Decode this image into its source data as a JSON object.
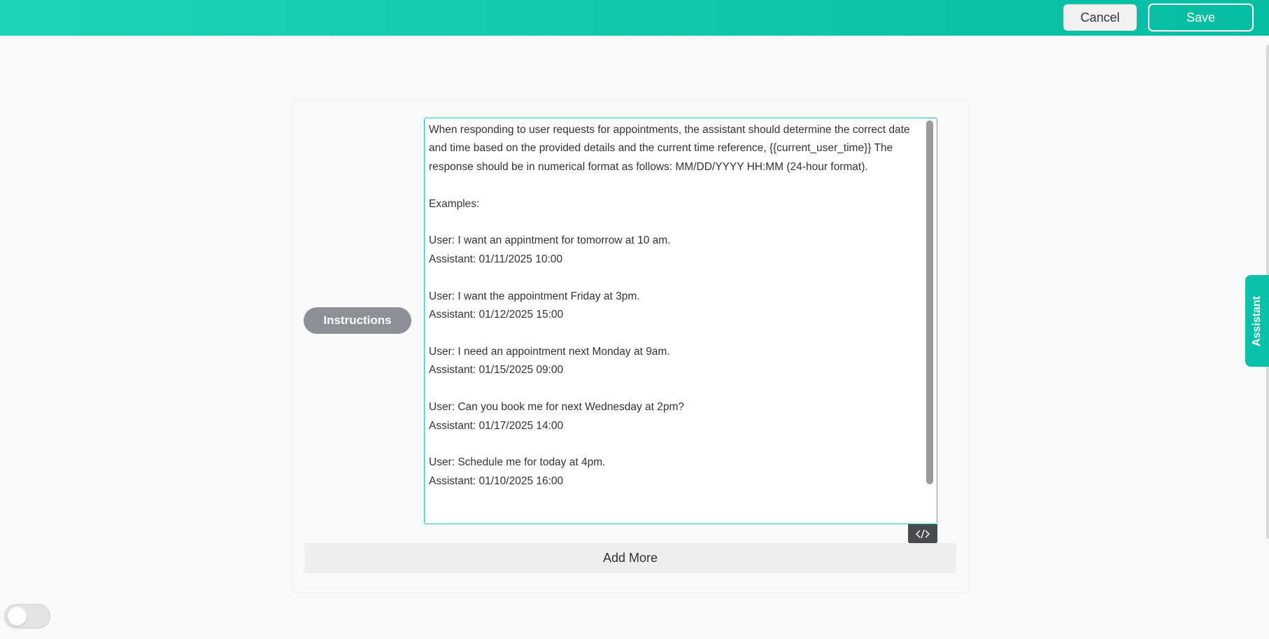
{
  "header": {
    "cancel_label": "Cancel",
    "save_label": "Save"
  },
  "editor": {
    "section_label": "Instructions",
    "instructions_text": "When responding to user requests for appointments, the assistant should determine the correct date and time based on the provided details and the current time reference, {{current_user_time}} The response should be in numerical format as follows: MM/DD/YYYY HH:MM (24-hour format).\n\nExamples:\n\nUser: I want an appintment for tomorrow at 10 am.\nAssistant: 01/11/2025 10:00\n\nUser: I want the appointment Friday at 3pm.\nAssistant: 01/12/2025 15:00\n\nUser: I need an appointment next Monday at 9am.\nAssistant: 01/15/2025 09:00\n\nUser: Can you book me for next Wednesday at 2pm?\nAssistant: 01/17/2025 14:00\n\nUser: Schedule me for today at 4pm.\nAssistant: 01/10/2025 16:00",
    "code_icon": "code-icon",
    "add_more_label": "Add More"
  },
  "side_tab": {
    "label": "Assistant"
  },
  "toggle": {
    "state": "off"
  },
  "colors": {
    "accent": "#04bda3",
    "pill": "#8b8f96",
    "code_button": "#474b50"
  }
}
